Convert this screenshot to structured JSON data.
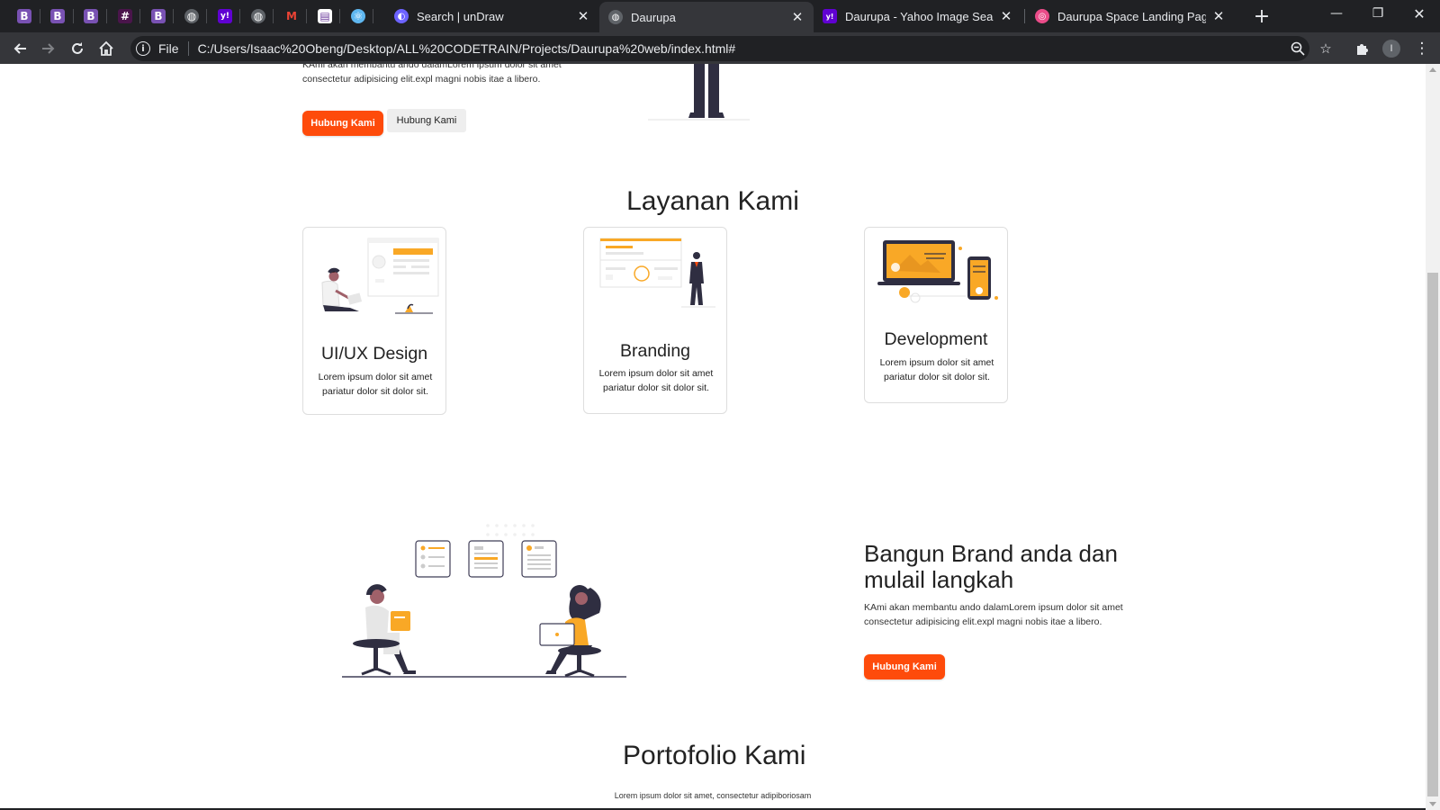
{
  "browser": {
    "pinned_tabs": [
      {
        "icon": "bootstrap-icon",
        "glyph": "B",
        "color": "#7952b3"
      },
      {
        "icon": "bootstrap-icon",
        "glyph": "B",
        "color": "#7952b3"
      },
      {
        "icon": "bootstrap-icon",
        "glyph": "B",
        "color": "#7952b3"
      },
      {
        "icon": "slack-icon",
        "glyph": "#",
        "color": "#4a154b"
      },
      {
        "icon": "bootstrap-icon",
        "glyph": "B",
        "color": "#7952b3"
      },
      {
        "icon": "globe-icon",
        "glyph": "◍",
        "color": "#5f6368"
      },
      {
        "icon": "yahoo-icon",
        "glyph": "y!",
        "color": "#6001d2"
      },
      {
        "icon": "globe-icon",
        "glyph": "◍",
        "color": "#5f6368"
      },
      {
        "icon": "gmail-icon",
        "glyph": "M",
        "color": "#202124"
      },
      {
        "icon": "document-icon",
        "glyph": "▤",
        "color": "#ffffff"
      },
      {
        "icon": "react-icon",
        "glyph": "⚛",
        "color": "#5fb7f0"
      }
    ],
    "tabs": [
      {
        "title": "Search | unDraw",
        "icon": "undraw-icon",
        "active": false
      },
      {
        "title": "Daurupa",
        "icon": "globe-icon",
        "active": true
      },
      {
        "title": "Daurupa - Yahoo Image Search R",
        "icon": "yahoo-icon",
        "active": false
      },
      {
        "title": "Daurupa Space Landing Page by",
        "icon": "dribbble-icon",
        "active": false
      }
    ],
    "address": {
      "scheme": "File",
      "url": "C:/Users/Isaac%20Obeng/Desktop/ALL%20CODETRAIN/Projects/Daurupa%20web/index.html#"
    },
    "profile_initial": "I"
  },
  "hero": {
    "desc": "KAmi akan membantu ando dalamLorem ipsum dolor sit amet consectetur adipisicing elit.expl magni nobis itae a libero.",
    "primary_button": "Hubung Kami",
    "secondary_button": "Hubung Kami"
  },
  "services": {
    "title": "Layanan Kami",
    "cards": [
      {
        "title": "UI/UX Design",
        "desc": "Lorem ipsum dolor sit amet pariatur dolor sit dolor sit."
      },
      {
        "title": "Branding",
        "desc": "Lorem ipsum dolor sit amet pariatur dolor sit dolor sit."
      },
      {
        "title": "Development",
        "desc": "Lorem ipsum dolor sit amet pariatur dolor sit dolor sit."
      }
    ]
  },
  "brand": {
    "title": "Bangun Brand anda dan mulail langkah",
    "desc": "KAmi akan membantu ando dalamLorem ipsum dolor sit amet consectetur adipisicing elit.expl magni nobis itae a libero.",
    "button": "Hubung Kami"
  },
  "portfolio": {
    "title": "Portofolio Kami",
    "subtitle": "Lorem ipsum dolor sit amet, consectetur adipiboriosam"
  },
  "colors": {
    "accent": "#fe4b0b",
    "illustration_accent": "#f9a826",
    "chrome_dark": "#202124",
    "chrome_toolbar": "#35363a"
  }
}
